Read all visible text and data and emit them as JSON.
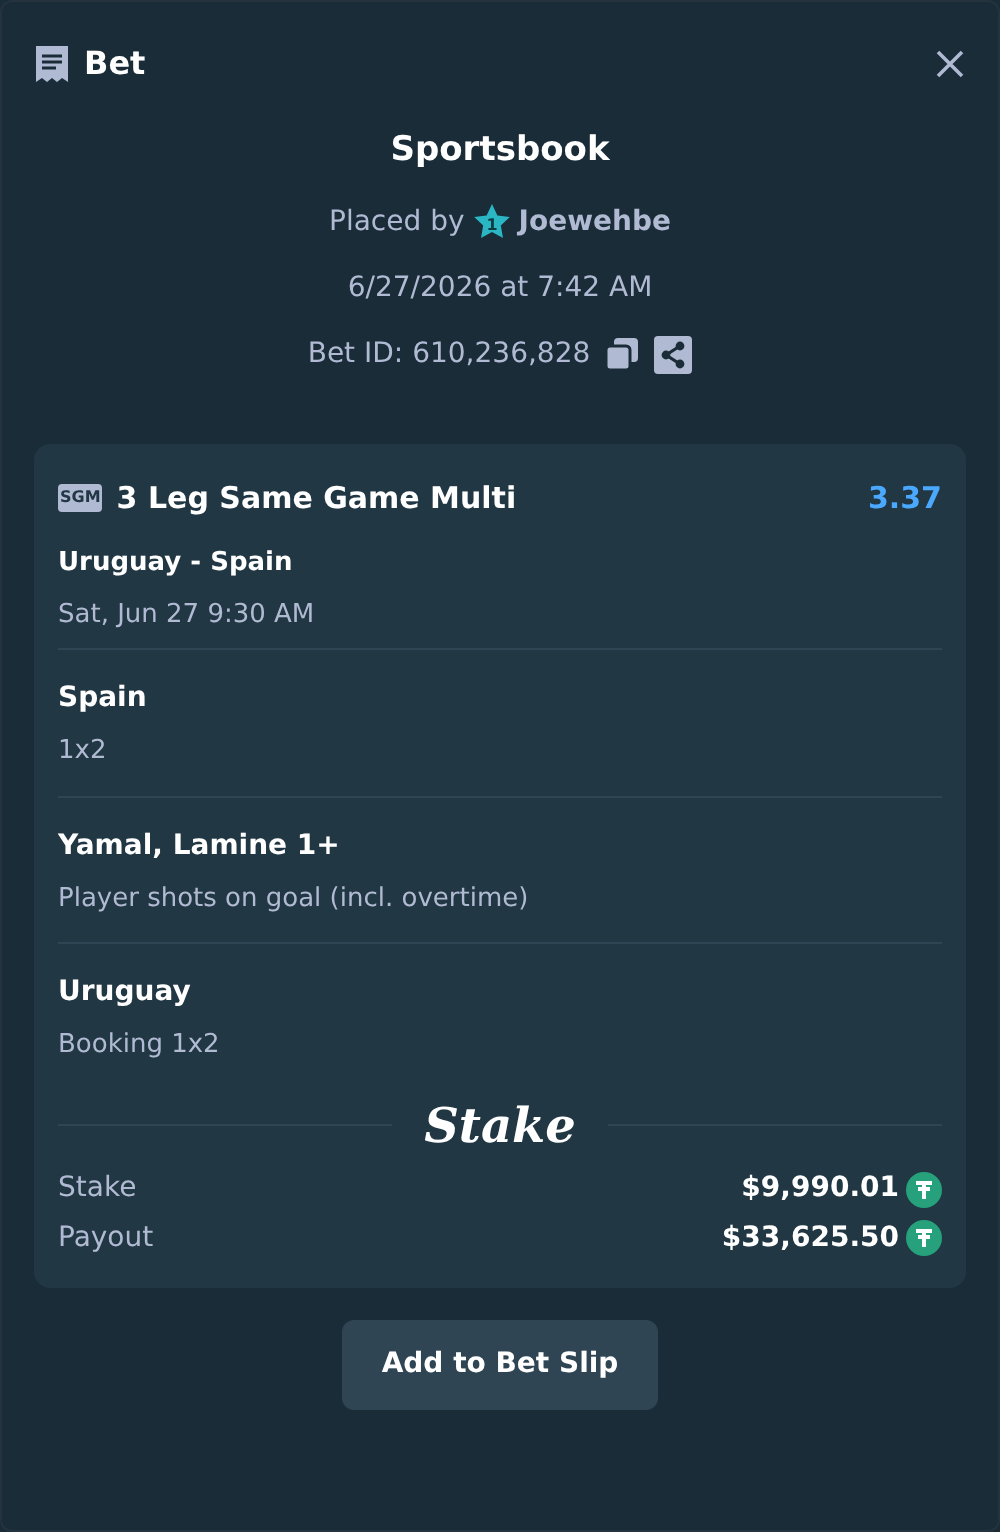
{
  "header": {
    "title": "Bet"
  },
  "summary": {
    "title": "Sportsbook",
    "placed_by_label": "Placed by",
    "user": "Joewehbe",
    "user_rank": "1",
    "date": "6/27/2026 at 7:42 AM",
    "bet_id": "Bet ID: 610,236,828"
  },
  "bet": {
    "badge": "SGM",
    "title": "3 Leg Same Game Multi",
    "odds": "3.37",
    "match": "Uruguay - Spain",
    "match_time": "Sat, Jun 27 9:30 AM",
    "legs": [
      {
        "selection": "Spain",
        "market": "1x2"
      },
      {
        "selection": "Yamal, Lamine 1+",
        "market": "Player shots on goal (incl. overtime)"
      },
      {
        "selection": "Uruguay",
        "market": "Booking 1x2"
      }
    ],
    "logo": "Stake",
    "totals": [
      {
        "label": "Stake",
        "amount": "$9,990.01"
      },
      {
        "label": "Payout",
        "amount": "$33,625.50"
      }
    ]
  },
  "button": "Add to Bet Slip"
}
